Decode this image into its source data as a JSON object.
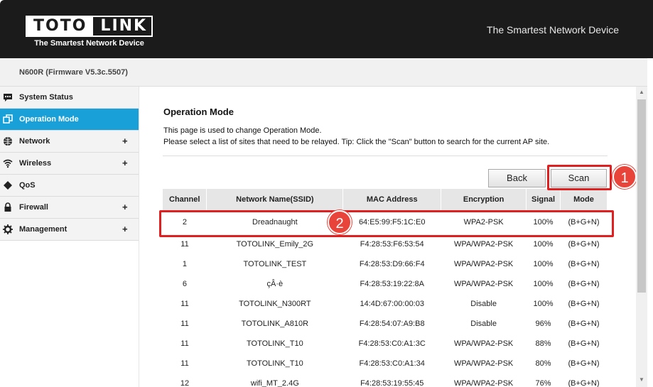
{
  "header": {
    "logo_left": "TOTO",
    "logo_right": "LINK",
    "logo_sub": "The Smartest Network Device",
    "slogan": "The Smartest Network Device"
  },
  "model": "N600R (Firmware V5.3c.5507)",
  "sidebar": {
    "items": [
      {
        "label": "System Status",
        "icon": "chat-icon",
        "expand": ""
      },
      {
        "label": "Operation Mode",
        "icon": "window-icon",
        "expand": "",
        "active": true
      },
      {
        "label": "Network",
        "icon": "globe-icon",
        "expand": "+"
      },
      {
        "label": "Wireless",
        "icon": "wifi-icon",
        "expand": "+"
      },
      {
        "label": "QoS",
        "icon": "qos-icon",
        "expand": ""
      },
      {
        "label": "Firewall",
        "icon": "lock-icon",
        "expand": "+"
      },
      {
        "label": "Management",
        "icon": "gear-icon",
        "expand": "+"
      }
    ]
  },
  "main": {
    "title": "Operation Mode",
    "desc1": "This page is used to change Operation Mode.",
    "desc2": "Please select a list of sites that need to be relayed. Tip: Click the \"Scan\" button to search for the current AP site.",
    "back_label": "Back",
    "scan_label": "Scan"
  },
  "annotations": {
    "badge1": "1",
    "badge2": "2"
  },
  "table": {
    "headers": [
      "Channel",
      "Network Name(SSID)",
      "MAC Address",
      "Encryption",
      "Signal",
      "Mode"
    ],
    "rows": [
      [
        "2",
        "Dreadnaught",
        "64:E5:99:F5:1C:E0",
        "WPA2-PSK",
        "100%",
        "(B+G+N)"
      ],
      [
        "11",
        "TOTOLINK_Emily_2G",
        "F4:28:53:F6:53:54",
        "WPA/WPA2-PSK",
        "100%",
        "(B+G+N)"
      ],
      [
        "1",
        "TOTOLINK_TEST",
        "F4:28:53:D9:66:F4",
        "WPA/WPA2-PSK",
        "100%",
        "(B+G+N)"
      ],
      [
        "6",
        "çÂ·è",
        "F4:28:53:19:22:8A",
        "WPA/WPA2-PSK",
        "100%",
        "(B+G+N)"
      ],
      [
        "11",
        "TOTOLINK_N300RT",
        "14:4D:67:00:00:03",
        "Disable",
        "100%",
        "(B+G+N)"
      ],
      [
        "11",
        "TOTOLINK_A810R",
        "F4:28:54:07:A9:B8",
        "Disable",
        "96%",
        "(B+G+N)"
      ],
      [
        "11",
        "TOTOLINK_T10",
        "F4:28:53:C0:A1:3C",
        "WPA/WPA2-PSK",
        "88%",
        "(B+G+N)"
      ],
      [
        "11",
        "TOTOLINK_T10",
        "F4:28:53:C0:A1:34",
        "WPA/WPA2-PSK",
        "80%",
        "(B+G+N)"
      ],
      [
        "12",
        "wifi_MT_2.4G",
        "F4:28:53:19:55:45",
        "WPA/WPA2-PSK",
        "76%",
        "(B+G+N)"
      ]
    ]
  },
  "colors": {
    "accent": "#1aa0d8",
    "header_bg": "#1b1b1b",
    "highlight": "#e02020"
  }
}
